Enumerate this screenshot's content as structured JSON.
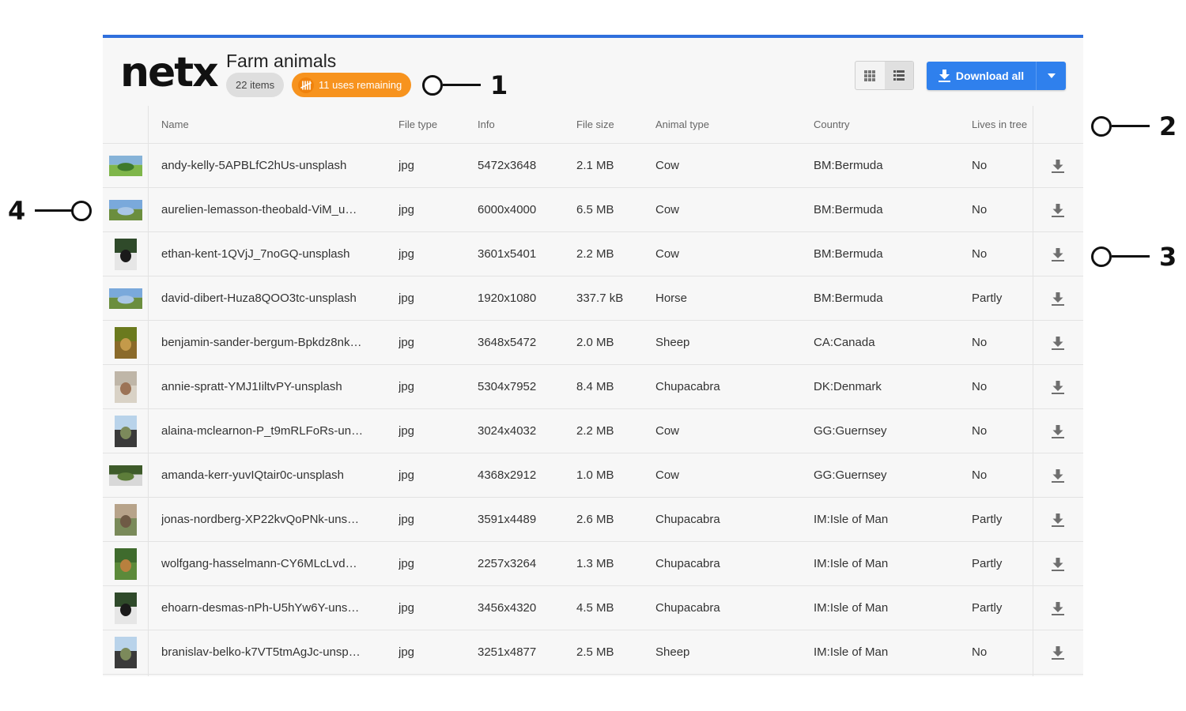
{
  "app": {
    "logo": "netx",
    "title": "Farm animals",
    "items_badge": "22 items",
    "uses_badge": "11 uses remaining",
    "download_all_label": "Download all",
    "accent_color": "#2f80ed",
    "uses_color": "#f7931e"
  },
  "view_toggle": {
    "options": [
      "grid-view-icon",
      "list-view-icon"
    ],
    "selected": "list"
  },
  "table": {
    "headers": [
      "Name",
      "File type",
      "Info",
      "File size",
      "Animal type",
      "Country",
      "Lives in tree"
    ],
    "rows": [
      {
        "name": "andy-kelly-5APBLfC2hUs-unsplash",
        "type": "jpg",
        "info": "5472x3648",
        "size": "2.1 MB",
        "animal": "Cow",
        "country": "BM:Bermuda",
        "tree": "No",
        "thumb": "landscape-green"
      },
      {
        "name": "aurelien-lemasson-theobald-ViM_u…",
        "type": "jpg",
        "info": "6000x4000",
        "size": "6.5 MB",
        "animal": "Cow",
        "country": "BM:Bermuda",
        "tree": "No",
        "thumb": "landscape-sky"
      },
      {
        "name": "ethan-kent-1QVjJ_7noGQ-unsplash",
        "type": "jpg",
        "info": "3601x5401",
        "size": "2.2 MB",
        "animal": "Cow",
        "country": "BM:Bermuda",
        "tree": "No",
        "thumb": "portrait-dark"
      },
      {
        "name": "david-dibert-Huza8QOO3tc-unsplash",
        "type": "jpg",
        "info": "1920x1080",
        "size": "337.7 kB",
        "animal": "Horse",
        "country": "BM:Bermuda",
        "tree": "Partly",
        "thumb": "landscape-sky"
      },
      {
        "name": "benjamin-sander-bergum-Bpkdz8nk…",
        "type": "jpg",
        "info": "3648x5472",
        "size": "2.0 MB",
        "animal": "Sheep",
        "country": "CA:Canada",
        "tree": "No",
        "thumb": "portrait-olive"
      },
      {
        "name": "annie-spratt-YMJ1IiltvPY-unsplash",
        "type": "jpg",
        "info": "5304x7952",
        "size": "8.4 MB",
        "animal": "Chupacabra",
        "country": "DK:Denmark",
        "tree": "No",
        "thumb": "portrait-light"
      },
      {
        "name": "alaina-mclearnon-P_t9mRLFoRs-un…",
        "type": "jpg",
        "info": "3024x4032",
        "size": "2.2 MB",
        "animal": "Cow",
        "country": "GG:Guernsey",
        "tree": "No",
        "thumb": "portrait-sky"
      },
      {
        "name": "amanda-kerr-yuvIQtair0c-unsplash",
        "type": "jpg",
        "info": "4368x2912",
        "size": "1.0 MB",
        "animal": "Cow",
        "country": "GG:Guernsey",
        "tree": "No",
        "thumb": "landscape-dark"
      },
      {
        "name": "jonas-nordberg-XP22kvQoPNk-uns…",
        "type": "jpg",
        "info": "3591x4489",
        "size": "2.6 MB",
        "animal": "Chupacabra",
        "country": "IM:Isle of Man",
        "tree": "Partly",
        "thumb": "portrait-brown"
      },
      {
        "name": "wolfgang-hasselmann-CY6MLcLvd…",
        "type": "jpg",
        "info": "2257x3264",
        "size": "1.3 MB",
        "animal": "Chupacabra",
        "country": "IM:Isle of Man",
        "tree": "Partly",
        "thumb": "portrait-green"
      },
      {
        "name": "ehoarn-desmas-nPh-U5hYw6Y-uns…",
        "type": "jpg",
        "info": "3456x4320",
        "size": "4.5 MB",
        "animal": "Chupacabra",
        "country": "IM:Isle of Man",
        "tree": "Partly",
        "thumb": "portrait-dark"
      },
      {
        "name": "branislav-belko-k7VT5tmAgJc-unsp…",
        "type": "jpg",
        "info": "3251x4877",
        "size": "2.5 MB",
        "animal": "Sheep",
        "country": "IM:Isle of Man",
        "tree": "No",
        "thumb": "portrait-sky"
      }
    ]
  },
  "callouts": [
    "1",
    "2",
    "3",
    "4"
  ]
}
